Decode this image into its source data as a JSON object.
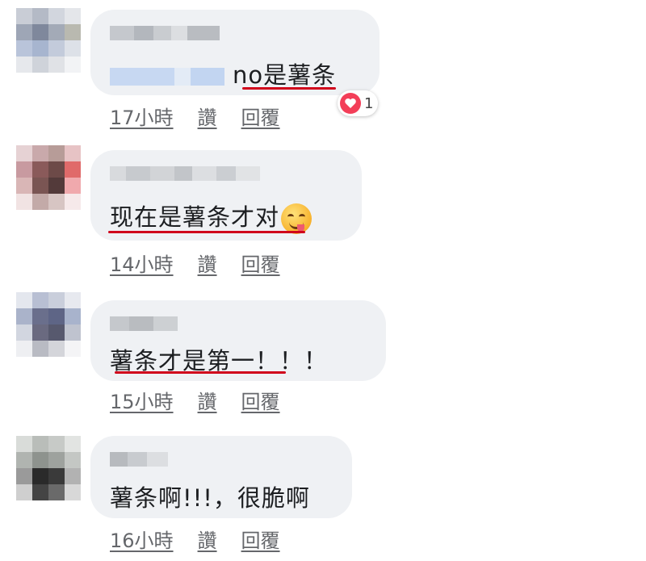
{
  "comments": [
    {
      "text_main": "no是薯条",
      "time": "17小時",
      "like": "讚",
      "reply": "回覆",
      "reaction": {
        "icon": "heart-icon",
        "count": "1"
      }
    },
    {
      "text_main": "现在是薯条才对",
      "emoji": "yum-face-emoji",
      "time": "14小時",
      "like": "讚",
      "reply": "回覆"
    },
    {
      "text_main": "薯条才是第一！！！",
      "time": "15小時",
      "like": "讚",
      "reply": "回覆"
    },
    {
      "text_main": "薯条啊!!!，很脆啊",
      "time": "16小時",
      "like": "讚",
      "reply": "回覆"
    }
  ],
  "colors": {
    "bubble": "#eff1f4",
    "underline": "#d0021b",
    "meta_text": "#65676b",
    "heart": "#f33e58"
  }
}
